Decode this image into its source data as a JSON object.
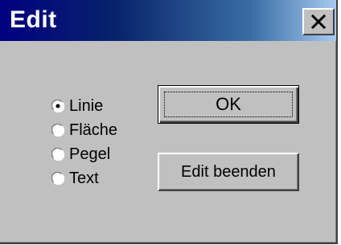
{
  "window": {
    "title": "Edit",
    "close_icon": "close-icon"
  },
  "radio_options": [
    {
      "label": "Linie",
      "checked": true
    },
    {
      "label": "Fläche",
      "checked": false
    },
    {
      "label": "Pegel",
      "checked": false
    },
    {
      "label": "Text",
      "checked": false
    }
  ],
  "buttons": {
    "ok_label": "OK",
    "end_label": "Edit beenden"
  },
  "colors": {
    "title_gradient_start": "#000080",
    "title_gradient_end": "#a6caf0",
    "face": "#c0c0c0"
  }
}
